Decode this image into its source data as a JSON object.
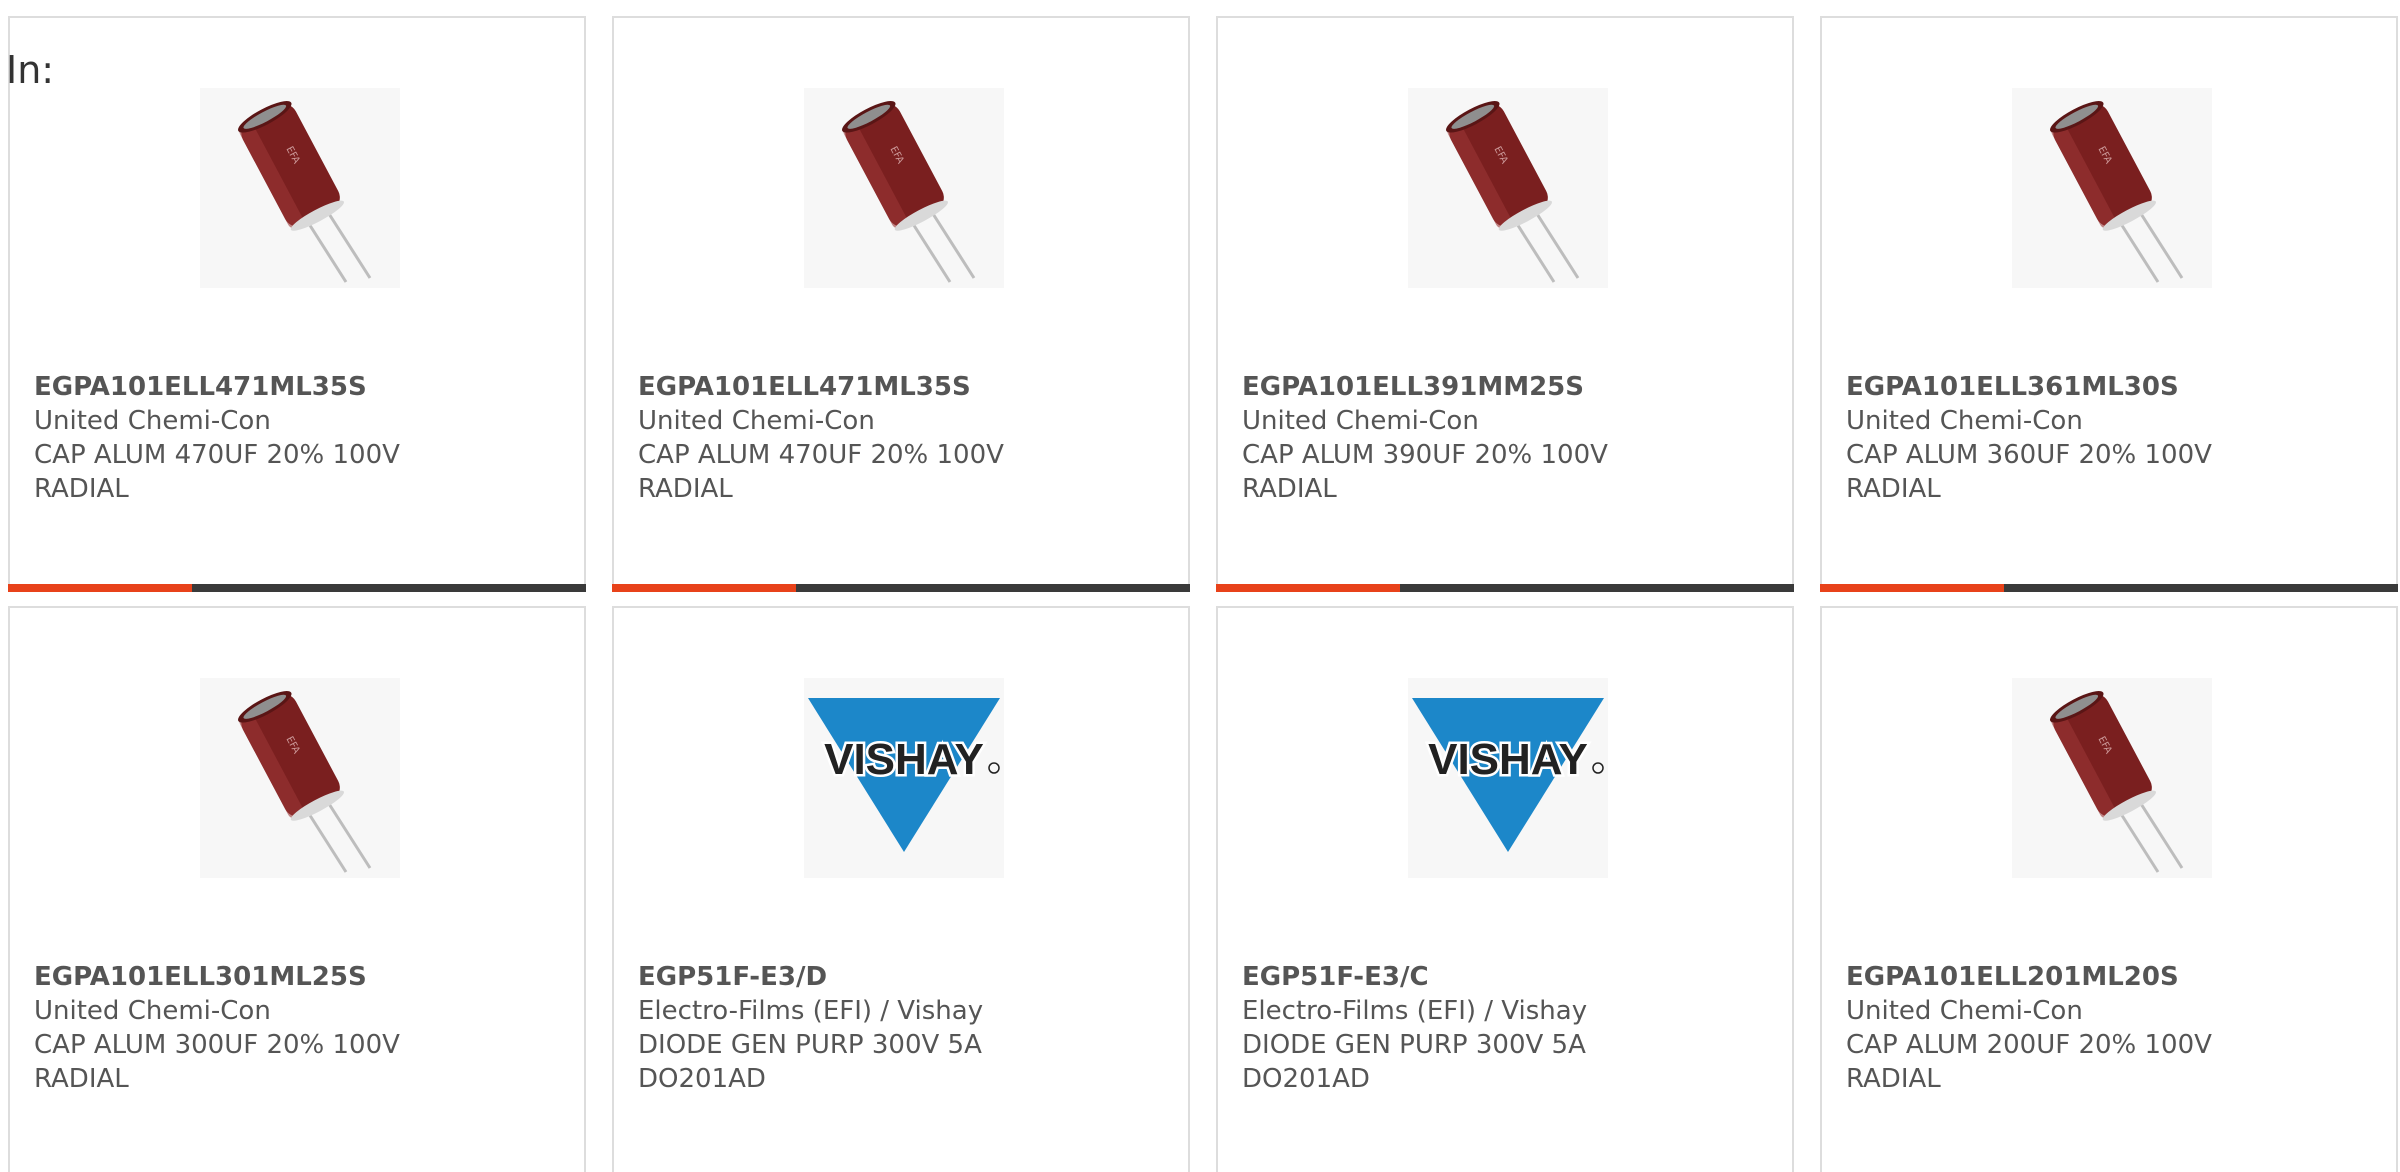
{
  "header": {
    "in_label": "In:"
  },
  "colors": {
    "accent": "#e8421a",
    "bar": "#3a3a3a",
    "vishay_blue": "#1c87c9",
    "capacitor": "#7a1f1f"
  },
  "products": [
    {
      "part_number": "EGPA101ELL471ML35S",
      "manufacturer": "United Chemi-Con",
      "desc1": "CAP ALUM 470UF 20% 100V",
      "desc2": "RADIAL",
      "image": "capacitor-icon"
    },
    {
      "part_number": "EGPA101ELL471ML35S",
      "manufacturer": "United Chemi-Con",
      "desc1": "CAP ALUM 470UF 20% 100V",
      "desc2": "RADIAL",
      "image": "capacitor-icon"
    },
    {
      "part_number": "EGPA101ELL391MM25S",
      "manufacturer": "United Chemi-Con",
      "desc1": "CAP ALUM 390UF 20% 100V",
      "desc2": "RADIAL",
      "image": "capacitor-icon"
    },
    {
      "part_number": "EGPA101ELL361ML30S",
      "manufacturer": "United Chemi-Con",
      "desc1": "CAP ALUM 360UF 20% 100V",
      "desc2": "RADIAL",
      "image": "capacitor-icon"
    },
    {
      "part_number": "EGPA101ELL301ML25S",
      "manufacturer": "United Chemi-Con",
      "desc1": "CAP ALUM 300UF 20% 100V",
      "desc2": "RADIAL",
      "image": "capacitor-icon"
    },
    {
      "part_number": "EGP51F-E3/D",
      "manufacturer": "Electro-Films (EFI) / Vishay",
      "desc1": "DIODE GEN PURP 300V 5A",
      "desc2": "DO201AD",
      "image": "vishay-logo",
      "logo_text": "VISHAY"
    },
    {
      "part_number": "EGP51F-E3/C",
      "manufacturer": "Electro-Films (EFI) / Vishay",
      "desc1": "DIODE GEN PURP 300V 5A",
      "desc2": "DO201AD",
      "image": "vishay-logo",
      "logo_text": "VISHAY"
    },
    {
      "part_number": "EGPA101ELL201ML20S",
      "manufacturer": "United Chemi-Con",
      "desc1": "CAP ALUM 200UF 20% 100V",
      "desc2": "RADIAL",
      "image": "capacitor-icon"
    }
  ]
}
